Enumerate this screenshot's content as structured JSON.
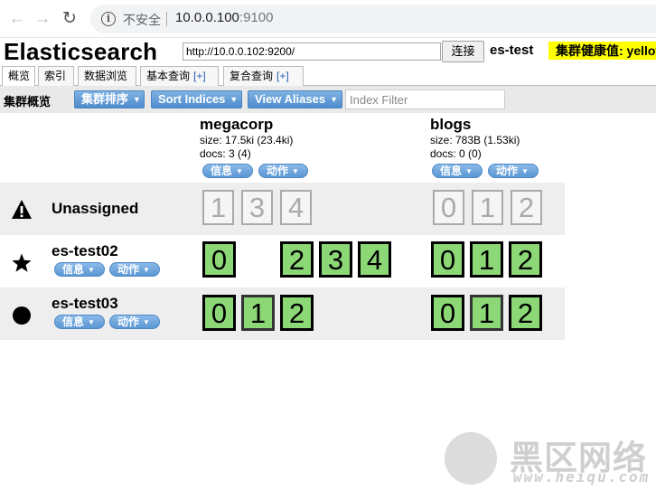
{
  "browser": {
    "security_label": "不安全",
    "url_host": "10.0.0.100",
    "url_port": ":9100",
    "back_icon": "arrow-left-icon",
    "forward_icon": "arrow-right-icon",
    "reload_icon": "reload-icon"
  },
  "header": {
    "title": "Elasticsearch",
    "connect_url": "http://10.0.0.102:9200/",
    "connect_label": "连接",
    "cluster_name": "es-test",
    "health_text": "集群健康值: yellow",
    "health_color": "#ffff00"
  },
  "tabs": [
    {
      "label": "概览",
      "plus": ""
    },
    {
      "label": "索引",
      "plus": ""
    },
    {
      "label": "数据浏览",
      "plus": ""
    },
    {
      "label": "基本查询",
      "plus": "[+]"
    },
    {
      "label": "复合查询",
      "plus": "[+]"
    }
  ],
  "toolbar": {
    "label": "集群概览",
    "sort_cluster": "集群排序",
    "sort_indices": "Sort Indices",
    "view_aliases": "View Aliases",
    "filter_placeholder": "Index Filter"
  },
  "indices": [
    {
      "name": "megacorp",
      "size": "size: 17.5ki (23.4ki)",
      "docs": "docs: 3 (4)",
      "info": "信息",
      "action": "动作"
    },
    {
      "name": "blogs",
      "size": "size: 783B (1.53ki)",
      "docs": "docs: 0 (0)",
      "info": "信息",
      "action": "动作"
    }
  ],
  "nodes": [
    {
      "name": "Unassigned",
      "icon": "warning-icon",
      "info": "",
      "action": "",
      "megacorp": [
        "1",
        "3",
        "4"
      ],
      "blogs": [
        "0",
        "1",
        "2"
      ]
    },
    {
      "name": "es-test02",
      "icon": "star-icon",
      "info": "信息",
      "action": "动作",
      "megacorp": [
        "0",
        "2",
        "3",
        "4"
      ],
      "blogs": [
        "0",
        "1",
        "2"
      ]
    },
    {
      "name": "es-test03",
      "icon": "circle-icon",
      "info": "信息",
      "action": "动作",
      "megacorp": [
        "0",
        "1",
        "2"
      ],
      "blogs": [
        "0",
        "1",
        "2"
      ]
    }
  ],
  "colors": {
    "shard_green": "#8dd876",
    "button_blue": "#5a97d4",
    "unassigned_gray": "#aaaaaa"
  },
  "watermark": {
    "text": "黑区网络",
    "url": "www.heiqu.com"
  }
}
